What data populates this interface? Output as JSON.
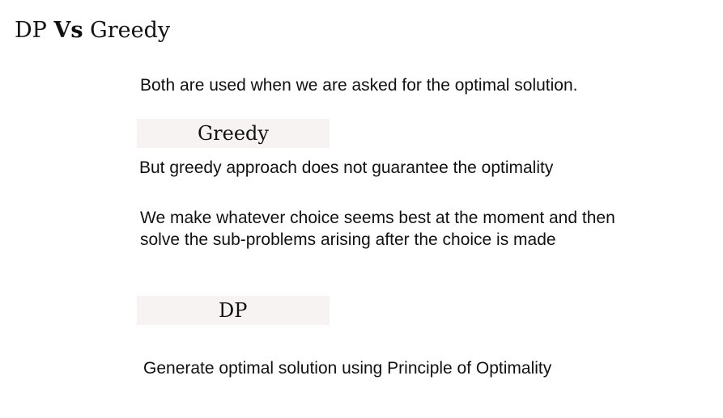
{
  "title": {
    "part1": "DP",
    "part2": "Vs",
    "part3": "Greedy"
  },
  "intro": "Both are used when we are asked for the optimal solution.",
  "greedy": {
    "heading": "Greedy",
    "point1": "But greedy approach does not guarantee the optimality",
    "point2_line1": "We make whatever choice seems best at the moment and then",
    "point2_line2": "solve the sub-problems arising after the choice is made"
  },
  "dp": {
    "heading": "DP",
    "point1": "Generate optimal solution using Principle of Optimality"
  }
}
